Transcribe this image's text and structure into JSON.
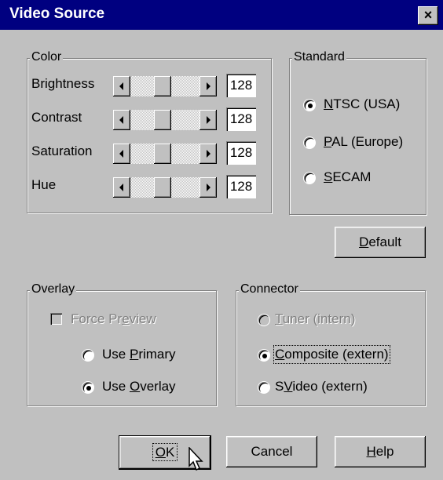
{
  "window": {
    "title": "Video Source",
    "close_glyph": "×"
  },
  "color_group": {
    "label": "Color",
    "rows": [
      {
        "label": "Brightness",
        "value": "128"
      },
      {
        "label": "Contrast",
        "value": "128"
      },
      {
        "label": "Saturation",
        "value": "128"
      },
      {
        "label": "Hue",
        "value": "128"
      }
    ]
  },
  "standard_group": {
    "label": "Standard",
    "options": [
      {
        "pre": "",
        "mnemonic": "N",
        "post": "TSC (USA)",
        "selected": true
      },
      {
        "pre": "",
        "mnemonic": "P",
        "post": "AL (Europe)",
        "selected": false
      },
      {
        "pre": "",
        "mnemonic": "S",
        "post": "ECAM",
        "selected": false
      }
    ]
  },
  "default_button": {
    "pre": "",
    "mnemonic": "D",
    "post": "efault"
  },
  "overlay_group": {
    "label": "Overlay",
    "force_preview": {
      "pre": "Force Pr",
      "mnemonic": "e",
      "post": "view",
      "checked": false,
      "disabled": true
    },
    "options": [
      {
        "pre": "Use ",
        "mnemonic": "P",
        "post": "rimary",
        "selected": false
      },
      {
        "pre": "Use ",
        "mnemonic": "O",
        "post": "verlay",
        "selected": true
      }
    ]
  },
  "connector_group": {
    "label": "Connector",
    "options": [
      {
        "pre": "",
        "mnemonic": "T",
        "post": "uner (intern)",
        "selected": false,
        "disabled": true
      },
      {
        "pre": "",
        "mnemonic": "C",
        "post": "omposite (extern)",
        "selected": true,
        "disabled": false
      },
      {
        "pre": "S",
        "mnemonic": "V",
        "post": "ideo (extern)",
        "selected": false,
        "disabled": false
      }
    ]
  },
  "buttons": {
    "ok": {
      "pre": "",
      "mnemonic": "O",
      "post": "K"
    },
    "cancel": "Cancel",
    "help": {
      "pre": "",
      "mnemonic": "H",
      "post": "elp"
    }
  },
  "colors": {
    "face": "#c0c0c0",
    "title_bg": "#000080",
    "shadow": "#808080"
  }
}
